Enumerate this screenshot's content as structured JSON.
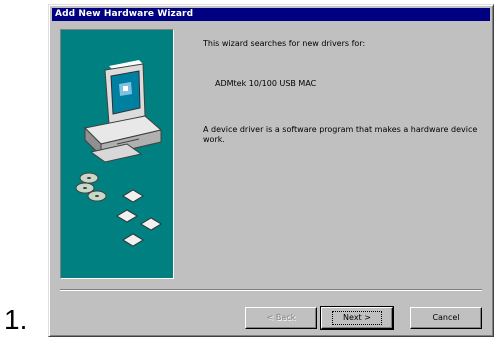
{
  "list_number": "1.",
  "window": {
    "title": "Add New Hardware Wizard"
  },
  "illustration": {
    "icon": "computer-with-cds-and-floppies-icon",
    "background_color": "#008080"
  },
  "content": {
    "intro": "This wizard searches for new drivers for:",
    "device_name": "ADMtek 10/100 USB MAC",
    "description": "A device driver is a software program that makes a hardware device work."
  },
  "buttons": {
    "back_label": "< Back",
    "next_label": "Next >",
    "cancel_label": "Cancel"
  },
  "colors": {
    "title_bar": "#000080",
    "dialog_face": "#c0c0c0",
    "panel": "#008080"
  }
}
